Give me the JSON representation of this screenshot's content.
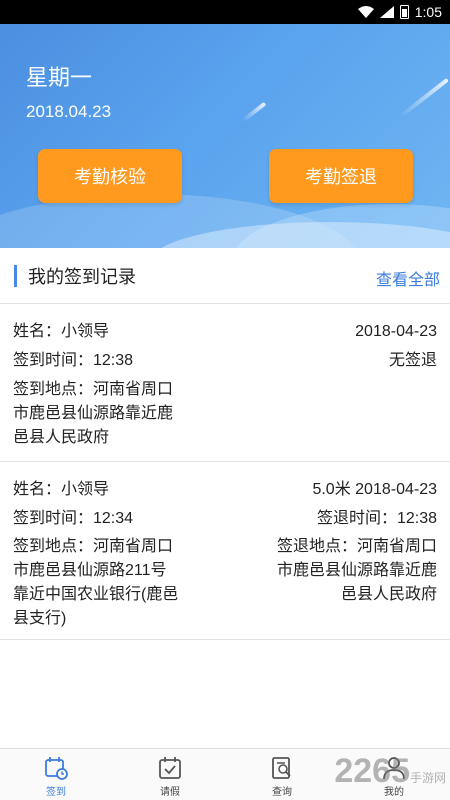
{
  "status_bar": {
    "time": "1:05"
  },
  "hero": {
    "weekday": "星期一",
    "date": "2018.04.23",
    "verify_button": "考勤核验",
    "signout_button": "考勤签退"
  },
  "section": {
    "title": "我的签到记录",
    "view_all": "查看全部"
  },
  "records": [
    {
      "name": "姓名：小领导",
      "date": "2018-04-23",
      "checkin_time": "签到时间：12:38",
      "status": "无签退",
      "checkin_location_lines": [
        "签到地点：河南省周口",
        "市鹿邑县仙源路靠近鹿",
        "邑县人民政府"
      ]
    },
    {
      "name": "姓名：小领导",
      "distance_date": "5.0米   2018-04-23",
      "checkin_time": "签到时间：12:34",
      "checkout_time": "签退时间：12:38",
      "checkin_location_lines": [
        "签到地点：河南省周口",
        "市鹿邑县仙源路211号",
        "靠近中国农业银行(鹿邑",
        "县支行)"
      ],
      "checkout_location_lines": [
        "签退地点：河南省周口",
        "市鹿邑县仙源路靠近鹿",
        "邑县人民政府"
      ]
    }
  ],
  "tabs": [
    {
      "label": "签到",
      "icon": "calendar-clock-icon",
      "active": true
    },
    {
      "label": "请假",
      "icon": "calendar-check-icon",
      "active": false
    },
    {
      "label": "查询",
      "icon": "document-search-icon",
      "active": false
    },
    {
      "label": "我的",
      "icon": "user-icon",
      "active": false
    }
  ],
  "watermark": {
    "text": "2265",
    "sub": "手游网"
  },
  "colors": {
    "accent": "#3b7ddd",
    "button": "#ff9a1f",
    "hero": "#5aa3ee"
  }
}
